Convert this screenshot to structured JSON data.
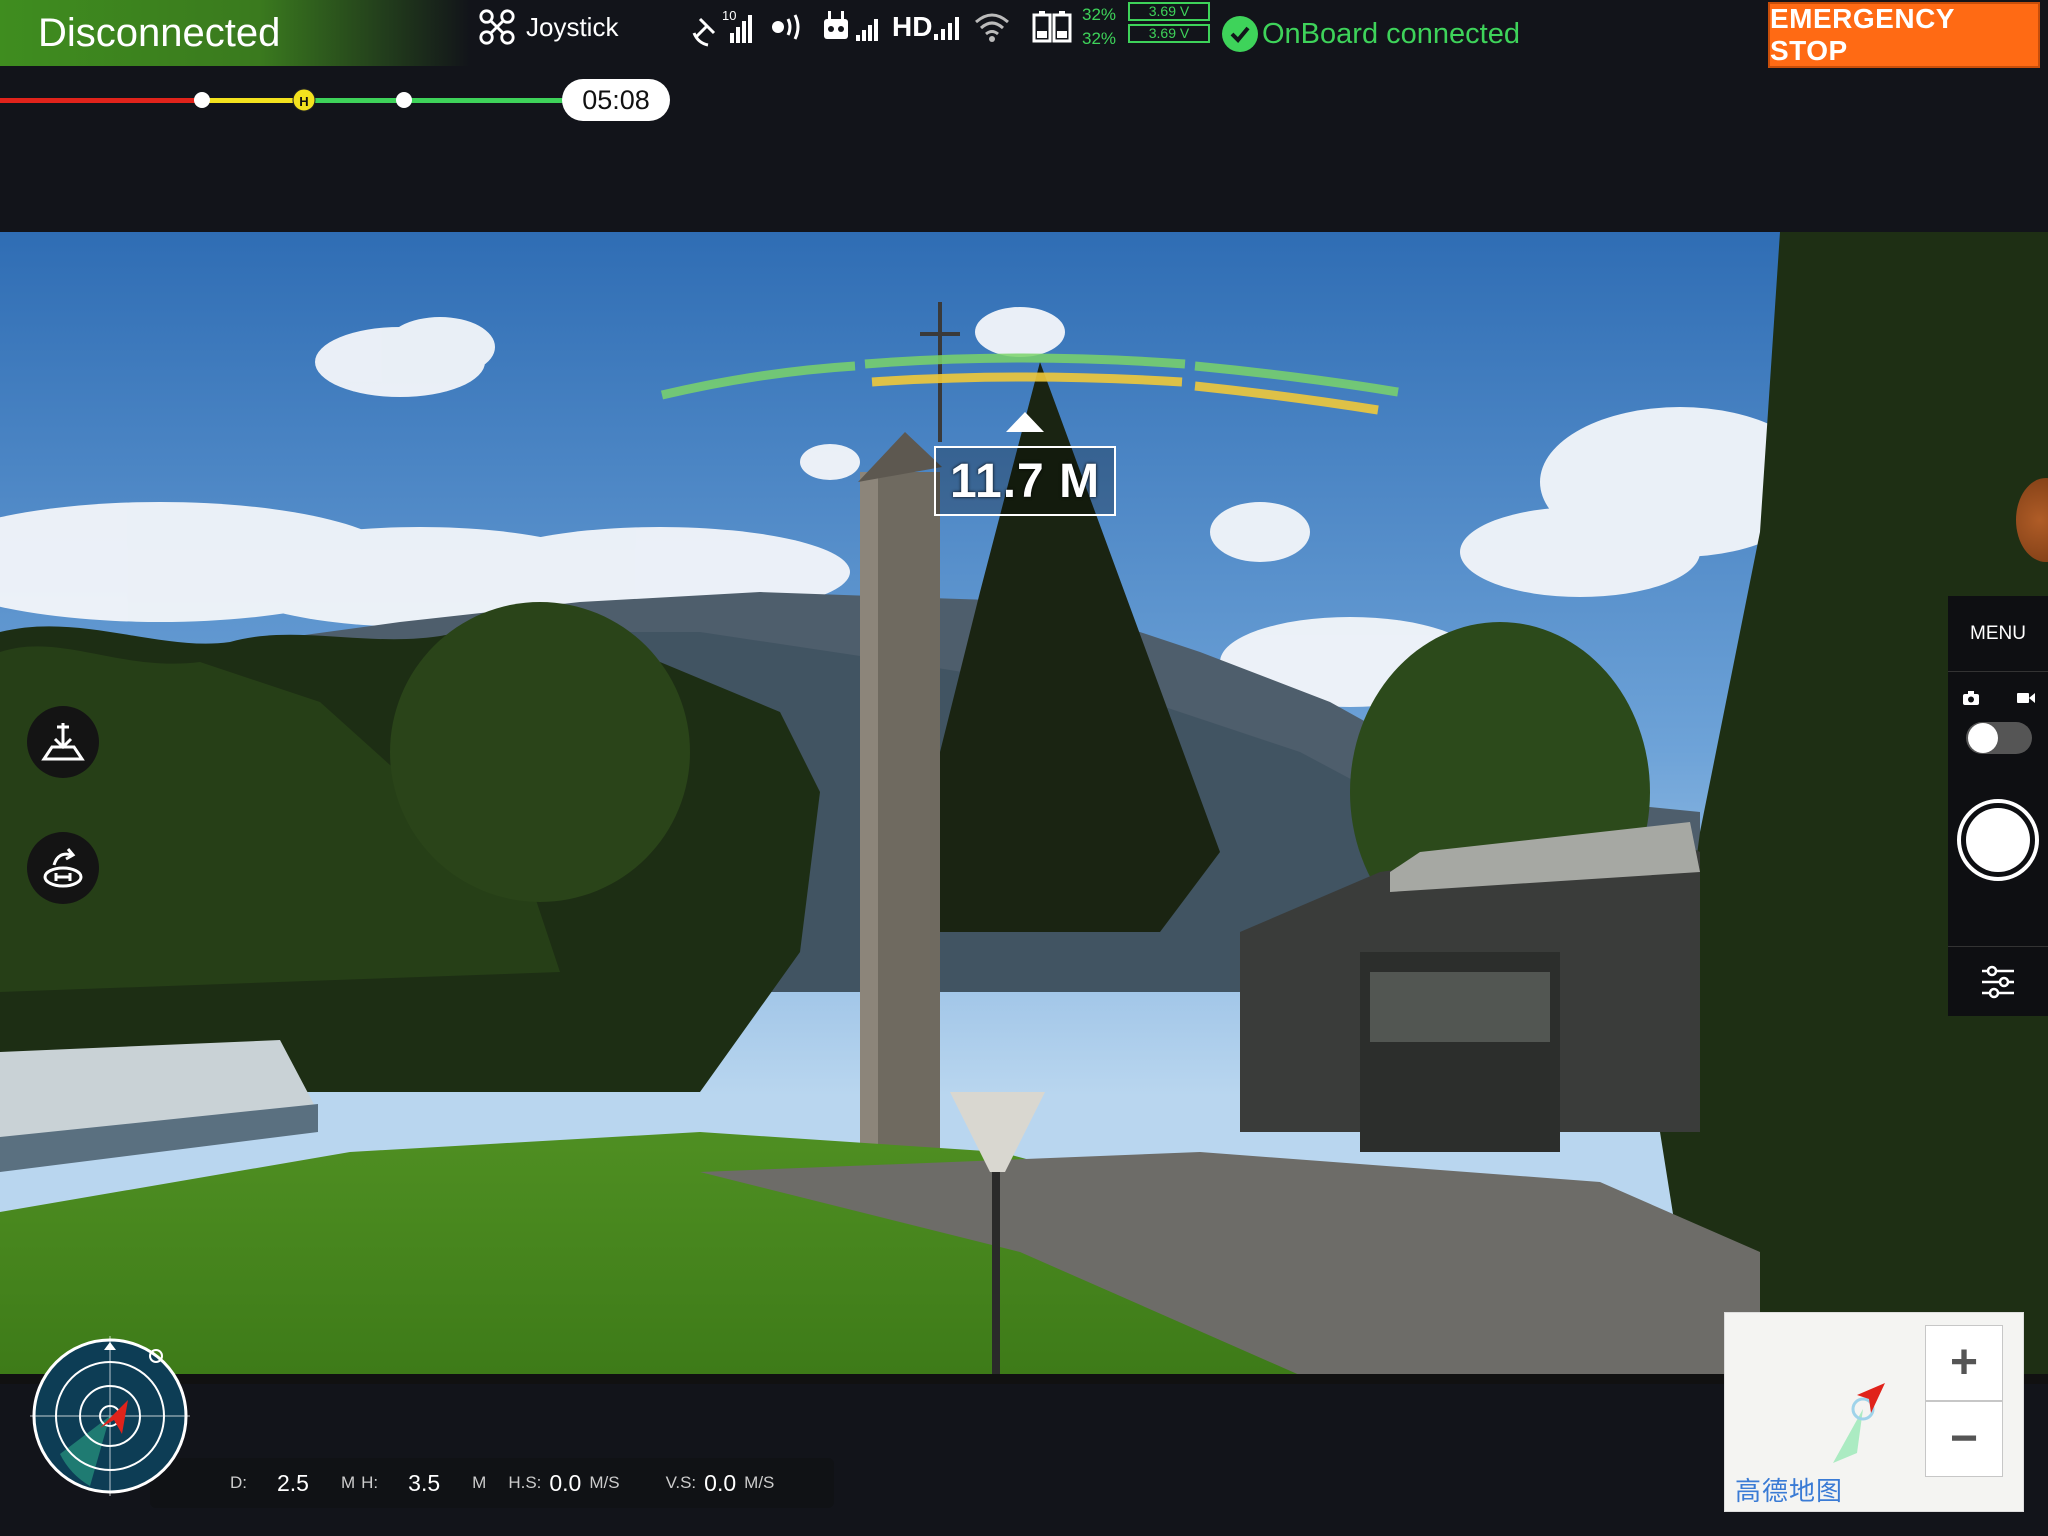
{
  "status": {
    "connection": "Disconnected"
  },
  "top_bar": {
    "mode_label": "Joystick",
    "satellite_count": "10",
    "hd_label": "HD",
    "battery_percent_1": "32%",
    "battery_percent_2": "32%",
    "voltage_1": "3.69 V",
    "voltage_2": "3.69 V",
    "onboard_status": "OnBoard connected",
    "emergency_label": "EMERGENCY STOP"
  },
  "battery_bar": {
    "home_marker": "H",
    "flight_time": "05:08"
  },
  "hud": {
    "altitude": "11.7 M"
  },
  "right_panel": {
    "menu_label": "MENU"
  },
  "telemetry": {
    "d_label": "D:",
    "d_value": "2.5",
    "d_unit": "M",
    "h_label": "H:",
    "h_value": "3.5",
    "h_unit": "M",
    "hs_label": "H.S:",
    "hs_value": "0.0",
    "hs_unit": "M/S",
    "vs_label": "V.S:",
    "vs_value": "0.0",
    "vs_unit": "M/S"
  },
  "minimap": {
    "provider_logo": "高德地图",
    "zoom_in": "+",
    "zoom_out": "−"
  },
  "colors": {
    "accent_green": "#3ed35a",
    "emergency_orange": "#ff6a14",
    "warn_yellow": "#f3e21e",
    "danger_red": "#e0231b"
  },
  "icons": [
    "drone-icon",
    "satellite-icon",
    "signal-icon",
    "remote-controller-icon",
    "wifi-icon",
    "battery-icon",
    "check-icon",
    "takeoff-icon",
    "return-home-icon",
    "camera-icon",
    "video-icon",
    "sliders-icon",
    "radar-icon",
    "aircraft-arrow-icon"
  ]
}
